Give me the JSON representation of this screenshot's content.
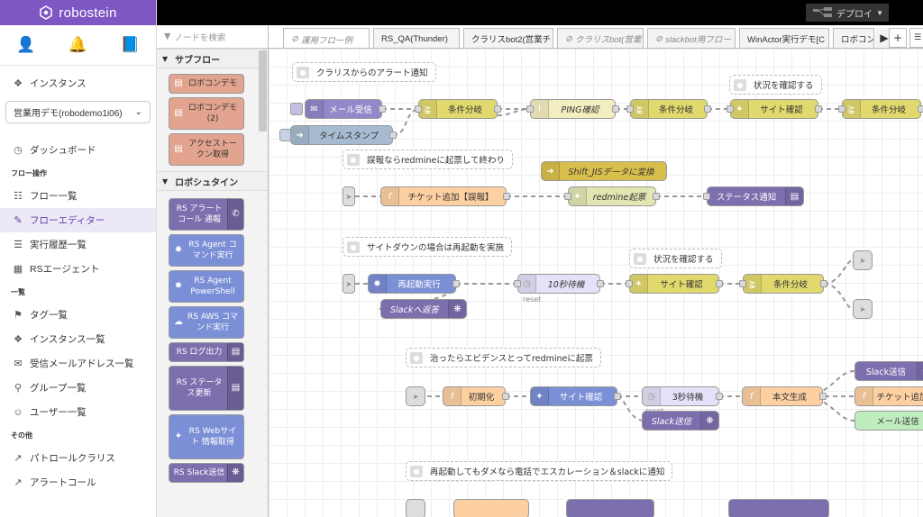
{
  "brand": {
    "name": "robostein",
    "color": "#7e57c2"
  },
  "sidebar": {
    "top_icons": [
      "user-icon",
      "bell-icon",
      "book-icon"
    ],
    "instance_label": "インスタンス",
    "instance_select": "営業用デモ(robodemo1i06)",
    "items_a": [
      {
        "label": "ダッシュボード",
        "icon": "dashboard-icon"
      }
    ],
    "sec1": "フロー操作",
    "items_b": [
      {
        "label": "フロー一覧",
        "icon": "flow-list-icon"
      },
      {
        "label": "フローエディター",
        "icon": "pencil-icon",
        "active": true
      },
      {
        "label": "実行履歴一覧",
        "icon": "list-icon"
      },
      {
        "label": "RSエージェント",
        "icon": "windows-icon"
      }
    ],
    "sec2": "一覧",
    "items_c": [
      {
        "label": "タグ一覧",
        "icon": "tag-icon"
      },
      {
        "label": "インスタンス一覧",
        "icon": "cubes-icon"
      },
      {
        "label": "受信メールアドレス一覧",
        "icon": "envelope-icon"
      },
      {
        "label": "グループ一覧",
        "icon": "key-icon"
      },
      {
        "label": "ユーザー一覧",
        "icon": "users-icon"
      }
    ],
    "sec3": "その他",
    "items_d": [
      {
        "label": "パトロールクラリス",
        "icon": "external-link-icon"
      },
      {
        "label": "アラートコール",
        "icon": "external-link-icon"
      }
    ]
  },
  "header": {
    "deploy_label": "デプロイ"
  },
  "palette": {
    "search_placeholder": "ノードを検索",
    "cat1": "サブフロー",
    "subflows": [
      "ロボコンデモ",
      "ロボコンデモ(2)",
      "アクセストークン取得"
    ],
    "cat2": "ロボシュタイン",
    "robo_nodes": [
      "RS アラートコール 通報",
      "RS Agent コマンド実行",
      "RS Agent PowerShell",
      "RS AWS コマンド実行",
      "RS ログ出力",
      "RS ステータス更新",
      "RS Webサイト 情報取得",
      "RS Slack送信"
    ]
  },
  "tabs": [
    "運用フロー例",
    "RS_QA(Thunder)",
    "クラリスbot2(営業チ",
    "クラリスbot(営業",
    "slackbot用フロー",
    "WinActor実行デモ[C",
    "ロボコン"
  ],
  "flow": {
    "comments": {
      "c1": "クラリスからのアラート通知",
      "c2": "状況を確認する",
      "c3": "誤報ならredmineに起票して終わり",
      "c4": "サイトダウンの場合は再起動を実施",
      "c5": "状況を確認する",
      "c6": "治ったらエビデンスとってredmineに起票",
      "c7": "再起動してもダメなら電話でエスカレーション＆slackに通知"
    },
    "nodes": {
      "mail": "メール受信",
      "timestamp": "タイムスタンプ",
      "switch1": "条件分岐",
      "ping": "PING確認",
      "switch2": "条件分岐",
      "site1": "サイト確認",
      "switch3": "条件分岐",
      "sjis": "Shift_JISデータに変換",
      "ticket": "チケット追加【誤報】",
      "redmine": "redmine起票",
      "status": "ステータス通知",
      "restart": "再起動実行",
      "wait10": "10秒待機",
      "site2": "サイト確認",
      "switch4": "条件分岐",
      "slackreturn": "Slackへ返答",
      "init": "初期化",
      "site3": "サイト確認",
      "wait3": "3秒待機",
      "body": "本文生成",
      "slack1": "Slack送信",
      "ticket2": "チケット追加",
      "mail2": "メール送信",
      "slack2": "Slack送信"
    },
    "reset1": "reset",
    "reset2": "reset"
  }
}
